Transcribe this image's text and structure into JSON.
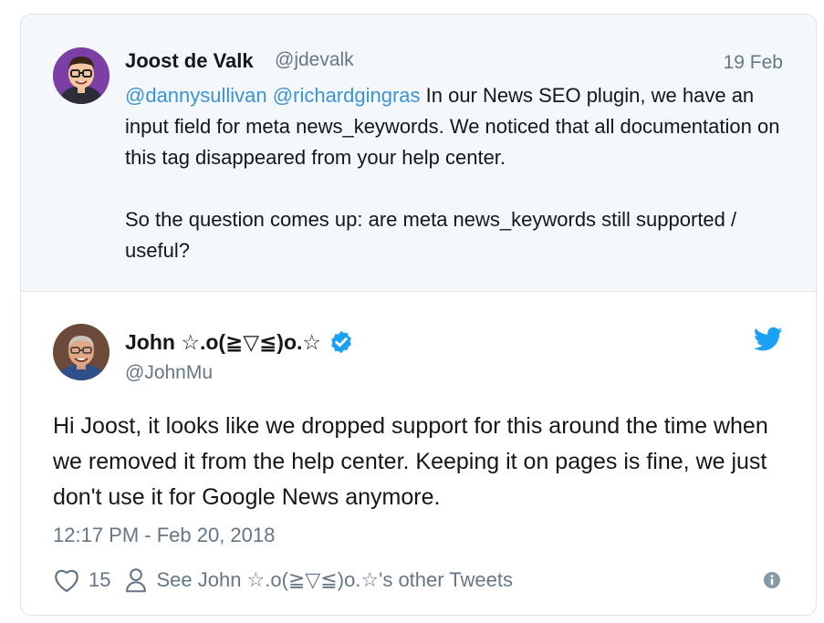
{
  "parent_tweet": {
    "author_name": "Joost de Valk",
    "author_handle": "@jdevalk",
    "date": "19 Feb",
    "mentions": [
      "@dannysullivan",
      "@richardgingras"
    ],
    "text_line1": " In our News SEO plugin, we have an input field for meta news_keywords. We noticed that all documentation on this tag disappeared from your help center.",
    "text_line2": "So the question comes up: are meta news_keywords still supported / useful?"
  },
  "main_tweet": {
    "author_name": "John ☆.o(≧▽≦)o.☆",
    "author_handle": "@JohnMu",
    "text": "Hi Joost, it looks like we dropped support for this around the time when we removed it from the help center. Keeping it on pages is fine, we just don't use it for Google News anymore.",
    "timestamp": "12:17 PM - Feb 20, 2018",
    "like_count": "15",
    "see_other_label": "See John ☆.o(≧▽≦)o.☆'s other Tweets"
  },
  "icons": {
    "verified": "verified-badge-icon",
    "brand": "twitter-bird-icon",
    "like": "heart-icon",
    "profile": "person-icon",
    "info": "info-icon"
  },
  "colors": {
    "link": "#3b94d9",
    "muted": "#657786",
    "twitter_blue": "#1da1f2",
    "parent_bg": "#f5f8fa"
  }
}
